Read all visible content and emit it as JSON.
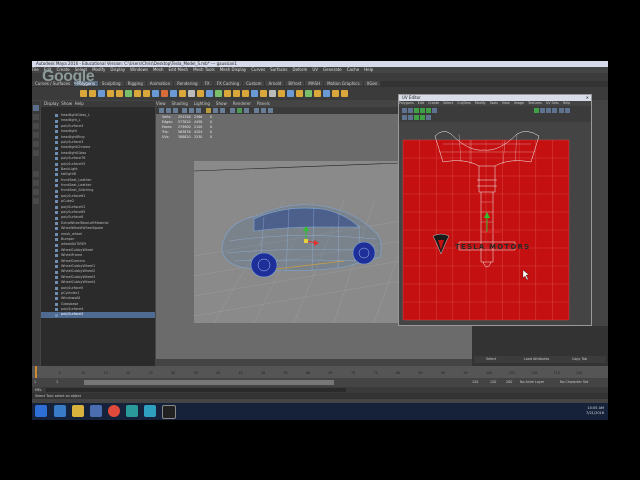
{
  "window": {
    "title": "Autodesk Maya 2016 - Educational Version: C:\\Users\\Chris\\Desktop\\Tesla_Model_S.mb*  ---  gaussian1"
  },
  "watermark": "Google",
  "menu": [
    "File",
    "Edit",
    "Create",
    "Select",
    "Modify",
    "Display",
    "Windows",
    "Mesh",
    "Edit Mesh",
    "Mesh Tools",
    "Mesh Display",
    "Curves",
    "Surfaces",
    "Deform",
    "UV",
    "Generate",
    "Cache",
    "Help"
  ],
  "shelf_tabs": [
    "Curves / Surfaces",
    "Polygons",
    "Sculpting",
    "Rigging",
    "Animation",
    "Rendering",
    "FX",
    "FX Caching",
    "Custom",
    "Arnold",
    "Bifrost",
    "MASH",
    "Motion Graphics",
    "XGen"
  ],
  "active_shelf_tab": "Polygons",
  "outliner": {
    "menu": [
      "Display",
      "Show",
      "Help"
    ],
    "items": [
      "headlightGlass_L",
      "headlight_L",
      "polySurface4",
      "headlight",
      "headlightRing",
      "polySurface3",
      "headlightChrome",
      "headlightGlass",
      "polySurface76",
      "polySurface55",
      "BackLight",
      "taillightR",
      "frontSeat_Leather",
      "frontSeat_Leather",
      "frontSeat_Stitching",
      "polySurface61",
      "pCube2",
      "polySurface52",
      "polySurface65",
      "polySurface8",
      "ExtraWheelRearLeftMaterial",
      "WheelWheelWheelSpoke",
      "mesh_wheel",
      "Bumper",
      "wheelAlkTIRE9",
      "WheelCubbyWheel",
      "WheelFrame",
      "WheelCamera",
      "WheelCubbyWheel1",
      "WheelCubbyWheel2",
      "WheelCubbyWheel3",
      "WheelCubbyWheel4",
      "polySurface5",
      "pCylinder1",
      "WindowsAll",
      "Glassbase",
      "polySurface4",
      "polySurface2"
    ],
    "selected_index": 37
  },
  "viewport": {
    "menu": [
      "View",
      "Shading",
      "Lighting",
      "Show",
      "Renderer",
      "Panels"
    ],
    "hud": [
      {
        "label": "Verts:",
        "v1": "291326",
        "v2": "2366",
        "v3": "0"
      },
      {
        "label": "Edges:",
        "v1": "577810",
        "v2": "4458",
        "v3": "0"
      },
      {
        "label": "Faces:",
        "v1": "279900",
        "v2": "2100",
        "v3": "0"
      },
      {
        "label": "Tris:",
        "v1": "563876",
        "v2": "4204",
        "v3": "0"
      },
      {
        "label": "UVs:",
        "v1": "386820",
        "v2": "2530",
        "v3": "0"
      }
    ]
  },
  "uv_editor": {
    "title": "UV Editor",
    "menu": [
      "Polygons",
      "Edit",
      "Create",
      "Select",
      "Cut/Sew",
      "Modify",
      "Tools",
      "View",
      "Image",
      "Textures",
      "UV Sets",
      "Help"
    ],
    "logo_text": "TESLA MOTORS",
    "background_color": "#c41010",
    "grid_color": "#e05050"
  },
  "right_panel": {
    "buttons": [
      "Select",
      "Load Attributes",
      "Copy Tab"
    ]
  },
  "timeline": {
    "ticks": [
      "1",
      "5",
      "10",
      "15",
      "20",
      "25",
      "30",
      "35",
      "40",
      "45",
      "50",
      "55",
      "60",
      "65",
      "70",
      "75",
      "80",
      "85",
      "90",
      "95",
      "100",
      "105",
      "110",
      "115",
      "120"
    ],
    "current_frame": "1"
  },
  "range": {
    "start": "1",
    "start_inner": "1",
    "end_inner": "120",
    "end": "120",
    "end2": "200",
    "anim_layer": "No Anim Layer",
    "char_set": "No Character Set"
  },
  "cmdline": {
    "label": "MEL"
  },
  "helpline": "Select Tool: select an object",
  "taskbar": {
    "time": "10:05 AM",
    "date": "7/21/2016"
  }
}
